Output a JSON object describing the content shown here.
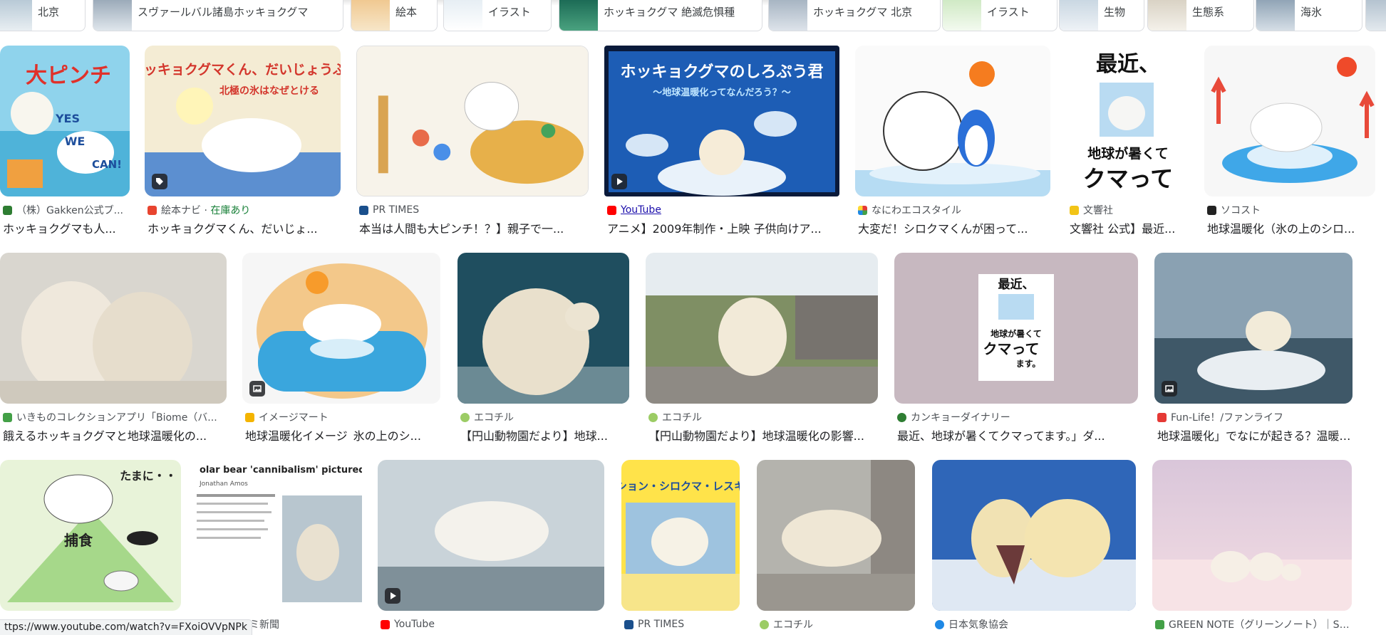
{
  "colors": {
    "accent_link": "#1a0dab",
    "stock_green": "#188038",
    "source_gray": "#4d5156"
  },
  "chips": [
    {
      "label": "北京"
    },
    {
      "label": "スヴァールバル諸島ホッキョクグマ"
    },
    {
      "label": "絵本"
    },
    {
      "label": "イラスト"
    },
    {
      "label": "ホッキョクグマ 絶滅危惧種"
    },
    {
      "label": "ホッキョクグマ 北京"
    },
    {
      "label": "イラスト"
    },
    {
      "label": "生物"
    },
    {
      "label": "生態系"
    },
    {
      "label": "海氷"
    }
  ],
  "rows": [
    [
      {
        "source": "（株）Gakken公式ブ...",
        "title": "ホッキョクグマも人...",
        "badge": ""
      },
      {
        "source": "絵本ナビ",
        "stock": "在庫あり",
        "title": "ホッキョクグマくん、だいじょ...",
        "badge": "tag-icon"
      },
      {
        "source": "PR TIMES",
        "title": "本当は人間も大ピンチ！？】親子で一...",
        "badge": ""
      },
      {
        "source": "YouTube",
        "title": "アニメ】2009年制作・上映 子供向けア...",
        "badge": "play-icon"
      },
      {
        "source": "なにわエコスタイル",
        "title": "大変だ！シロクマくんが困って...",
        "badge": ""
      },
      {
        "source": "文響社",
        "title": "文響社 公式】最近...",
        "badge": ""
      },
      {
        "source": "ソコスト",
        "title": "地球温暖化（氷の上のシロ...",
        "badge": ""
      }
    ],
    [
      {
        "source": "いきものコレクションアプリ「Biome（バ...",
        "title": "餓えるホッキョクグマと地球温暖化の...",
        "badge": ""
      },
      {
        "source": "イメージマート",
        "title": "地球温暖化イメージ_氷の上のシ...",
        "badge": "image-icon"
      },
      {
        "source": "エコチル",
        "title": "【円山動物園だより】地球...",
        "badge": ""
      },
      {
        "source": "エコチル",
        "title": "【円山動物園だより】地球温暖化の影響...",
        "badge": ""
      },
      {
        "source": "カンキョーダイナリー",
        "title": "最近、地球が暑くてクマってます。」ダ...",
        "badge": ""
      },
      {
        "source": "Fun-Life！/ファンライフ",
        "title": "地球温暖化」でなにが起きる？温暖化...",
        "badge": "image-icon"
      }
    ],
    [
      {
        "source": "",
        "title": "",
        "badge": "",
        "inner": "たまに・・"
      },
      {
        "source": "ヨミ新聞",
        "title": "",
        "badge": "",
        "inner": "olar bear 'cannibalism' pictured"
      },
      {
        "source": "YouTube",
        "title": "",
        "badge": "play-icon"
      },
      {
        "source": "PR TIMES",
        "title": "",
        "badge": "",
        "inner": "ミッション・シロクマ・レスキュー"
      },
      {
        "source": "エコチル",
        "title": "",
        "badge": ""
      },
      {
        "source": "日本気象協会",
        "title": "",
        "badge": ""
      },
      {
        "source": "GREEN NOTE（グリーンノート）｜SDG...",
        "title": "",
        "badge": ""
      }
    ]
  ],
  "thumb_text": {
    "book1_title": "大ピンチ",
    "book1_yes": "YES",
    "book1_we": "WE",
    "book1_can": "CAN!",
    "book2_title": "ホッキョクグマくん、だいじょうぶ?",
    "book2_sub": "北極の氷はなぜとける",
    "anime_title": "ホッキョクグマのしろぷう君",
    "anime_sub": "〜地球温暖化ってなんだろう？〜",
    "book_saikin": "最近、",
    "book_chikyu": "地球が暑くて",
    "book_kuma": "クマって",
    "book_masu": "ます。",
    "hunt_label": "捕食",
    "tamani": "たまに・・",
    "cannibal_head": "olar bear 'cannibalism' pictured",
    "cannibal_author": "Jonathan Amos",
    "mission_title": "ミッション・シロクマ・レスキュー"
  },
  "status_url": "ttps://www.youtube.com/watch?v=FXoiOVVpNPk"
}
